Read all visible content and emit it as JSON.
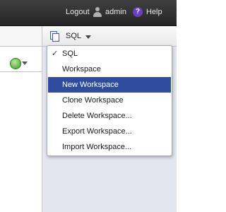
{
  "topbar": {
    "logout": "Logout",
    "username": "admin",
    "help_glyph": "?",
    "help": "Help"
  },
  "toolbar": {
    "sql_label": "SQL",
    "sql_icon": "sql-page-icon"
  },
  "menu": {
    "checked_index": 0,
    "highlighted_index": 2,
    "items": [
      {
        "label": "SQL"
      },
      {
        "label": "Workspace"
      },
      {
        "label": "New Workspace"
      },
      {
        "label": "Clone Workspace"
      },
      {
        "label": "Delete Workspace..."
      },
      {
        "label": "Export Workspace..."
      },
      {
        "label": "Import Workspace..."
      }
    ]
  },
  "colors": {
    "topbar": "#2e2e2e",
    "highlight": "#2f4c9e",
    "help_icon": "#6a3fc0"
  }
}
